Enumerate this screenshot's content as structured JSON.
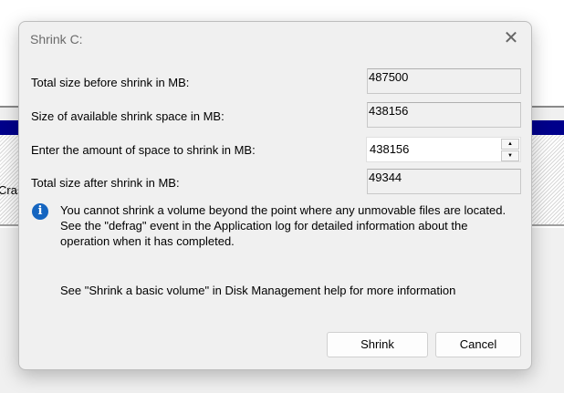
{
  "background": {
    "partial_text": "Cras"
  },
  "dialog": {
    "title": "Shrink C:",
    "fields": [
      {
        "label": "Total size before shrink in MB:",
        "value": "487500"
      },
      {
        "label": "Size of available shrink space in MB:",
        "value": "438156"
      },
      {
        "label": "Enter the amount of space to shrink in MB:",
        "value": "438156"
      },
      {
        "label": "Total size after shrink in MB:",
        "value": "49344"
      }
    ],
    "info_lines": [
      "You cannot shrink a volume beyond the point where any unmovable files are located.",
      "See the \"defrag\" event in the Application log for detailed information about the",
      "operation when it has completed."
    ],
    "help_text": "See \"Shrink a basic volume\" in Disk Management help for more information",
    "shrink_label": "Shrink",
    "cancel_label": "Cancel",
    "colors": {
      "info": "#1565c0",
      "header_bar": "#00008b"
    }
  }
}
